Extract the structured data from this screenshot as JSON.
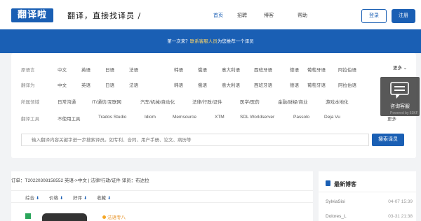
{
  "header": {
    "logo": "翻译啦",
    "slogan": "翻译，直接找译员 /",
    "nav": [
      "首页",
      "招聘",
      "博客",
      "帮助"
    ],
    "login": "登录",
    "register": "注册"
  },
  "banner": {
    "prefix": "第一次来？",
    "highlight": "联系客服人员",
    "suffix": "为您推荐一个译员"
  },
  "filters": {
    "more": "更多",
    "rows": [
      {
        "label": "原语言",
        "options": [
          "中文",
          "英语",
          "日语",
          "法语",
          "韩语",
          "俄语",
          "意大利语",
          "西班牙语",
          "德语",
          "葡萄牙语",
          "阿拉伯语"
        ]
      },
      {
        "label": "翻译为",
        "options": [
          "中文",
          "英语",
          "日语",
          "法语",
          "韩语",
          "俄语",
          "意大利语",
          "西班牙语",
          "德语",
          "葡萄牙语",
          "阿拉伯语"
        ]
      },
      {
        "label": "所属领域",
        "options": [
          "日常沟通",
          "IT/通信/互联网",
          "汽车/机械/自动化",
          "法律/行政/证件",
          "医学/医药",
          "金融/财经/商业",
          "游戏本地化"
        ]
      },
      {
        "label": "翻译工具",
        "options": [
          "不使用工具",
          "Trados Studio",
          "Idiom",
          "Memsource",
          "XTM",
          "SDL Worldserver",
          "Passolo",
          "Deja Vu"
        ]
      }
    ],
    "row4_more": "更多",
    "search_placeholder": "输入翻译内容关键字进一步搜索译员。如专利、合同、用户手册、论文、病历等",
    "search_button": "搜索译员"
  },
  "consult": {
    "label": "咨询客服",
    "powered": "Powered by 53KF"
  },
  "order": {
    "title": "订单：T20220308158552    英语->中文 | 法律/行政/证件    译员：布达拉",
    "sorts": [
      "综合",
      "价格",
      "好评",
      "收藏"
    ],
    "badge": "法语专八"
  },
  "blog": {
    "title": "最新博客",
    "items": [
      {
        "name": "SylviaSisi",
        "date": "04-07 15:39"
      },
      {
        "name": "Dolores_L",
        "date": "03-31 21:38"
      }
    ]
  },
  "colors": {
    "primary": "#1a5fb4",
    "accent": "#ffd666",
    "badge": "#f5a623"
  }
}
